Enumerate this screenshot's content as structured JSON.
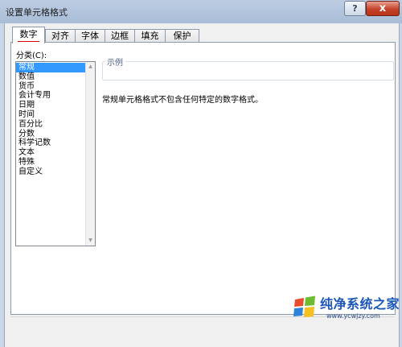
{
  "window": {
    "title": "设置单元格格式",
    "help_label": "?",
    "close_label": "x"
  },
  "tabs": [
    {
      "label": "数字",
      "active": true
    },
    {
      "label": "对齐"
    },
    {
      "label": "字体"
    },
    {
      "label": "边框"
    },
    {
      "label": "填充"
    },
    {
      "label": "保护"
    }
  ],
  "category": {
    "label": "分类(C):",
    "items": [
      "常规",
      "数值",
      "货币",
      "会计专用",
      "日期",
      "时间",
      "百分比",
      "分数",
      "科学记数",
      "文本",
      "特殊",
      "自定义"
    ],
    "selected": "常规"
  },
  "sample": {
    "legend": "示例",
    "value": ""
  },
  "description": "常规单元格格式不包含任何特定的数字格式。",
  "watermark": {
    "text": "纯净系统之家",
    "url": "www.ycwjzy.com"
  },
  "colors": {
    "selection": "#3399ff",
    "close_button": "#c5432b",
    "watermark_text": "#1b57b8"
  }
}
